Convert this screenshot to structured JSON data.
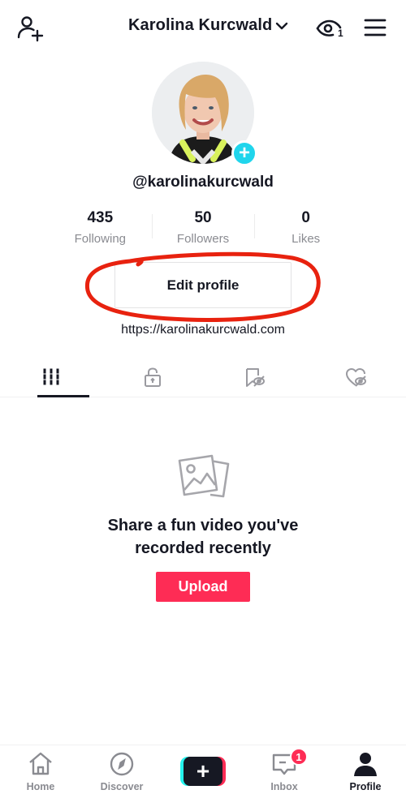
{
  "header": {
    "title": "Karolina Kurcwald",
    "viewers_count": "1",
    "icons": {
      "left": "add-user-icon",
      "dropdown": "chevron-down-icon",
      "views": "eye-icon",
      "menu": "hamburger-menu-icon"
    }
  },
  "profile": {
    "handle": "@karolinakurcwald",
    "avatar_add_icon": "+",
    "stats": [
      {
        "value": "435",
        "label": "Following"
      },
      {
        "value": "50",
        "label": "Followers"
      },
      {
        "value": "0",
        "label": "Likes"
      }
    ],
    "edit_button_label": "Edit profile",
    "website": "https://karolinakurcwald.com"
  },
  "content_tabs": [
    {
      "icon": "grid-videos-icon",
      "active": true
    },
    {
      "icon": "lock-icon",
      "active": false
    },
    {
      "icon": "bookmark-hidden-icon",
      "active": false
    },
    {
      "icon": "heart-hidden-icon",
      "active": false
    }
  ],
  "empty_state": {
    "icon": "photos-icon",
    "message_line1": "Share a fun video you've",
    "message_line2": "recorded recently",
    "upload_label": "Upload"
  },
  "bottom_nav": {
    "items": [
      {
        "label": "Home",
        "icon": "home-icon",
        "active": false
      },
      {
        "label": "Discover",
        "icon": "compass-icon",
        "active": false
      },
      {
        "label": "",
        "icon": "plus-icon",
        "active": false
      },
      {
        "label": "Inbox",
        "icon": "message-icon",
        "active": false,
        "badge": "1"
      },
      {
        "label": "Profile",
        "icon": "person-icon",
        "active": true
      }
    ],
    "create_symbol": "+"
  },
  "colors": {
    "accent": "#fe2c55",
    "avatar_add": "#20d5ec",
    "text": "#161823",
    "muted": "#8a8b91",
    "annotation": "#e8220f"
  }
}
